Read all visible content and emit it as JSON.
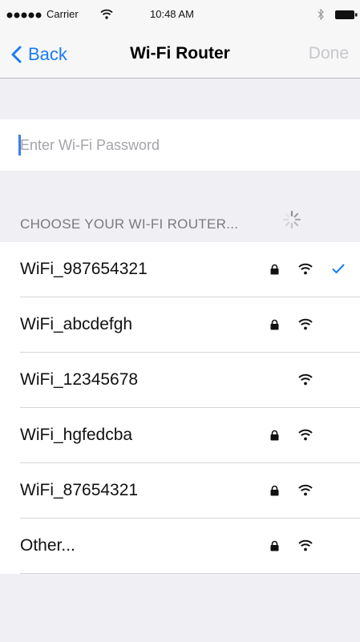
{
  "status_bar": {
    "carrier": "Carrier",
    "time": "10:48 AM",
    "signal_icon": "signal-dots-icon",
    "wifi_icon": "wifi-icon",
    "bluetooth_icon": "bluetooth-icon",
    "battery_icon": "battery-icon"
  },
  "nav": {
    "back_label": "Back",
    "title": "Wi-Fi Router",
    "done_label": "Done"
  },
  "password": {
    "placeholder": "Enter Wi-Fi Password",
    "value": ""
  },
  "section": {
    "header": "CHOOSE YOUR WI-FI ROUTER..."
  },
  "networks": [
    {
      "name": "WiFi_987654321",
      "locked": true,
      "selected": true
    },
    {
      "name": "WiFi_abcdefgh",
      "locked": true,
      "selected": false
    },
    {
      "name": "WiFi_12345678",
      "locked": false,
      "selected": false
    },
    {
      "name": "WiFi_hgfedcba",
      "locked": true,
      "selected": false
    },
    {
      "name": "WiFi_87654321",
      "locked": true,
      "selected": false
    },
    {
      "name": "Other...",
      "locked": true,
      "selected": false
    }
  ],
  "colors": {
    "accent": "#1a7cf6",
    "disabled": "#c7c7cc",
    "background": "#efeff4"
  }
}
